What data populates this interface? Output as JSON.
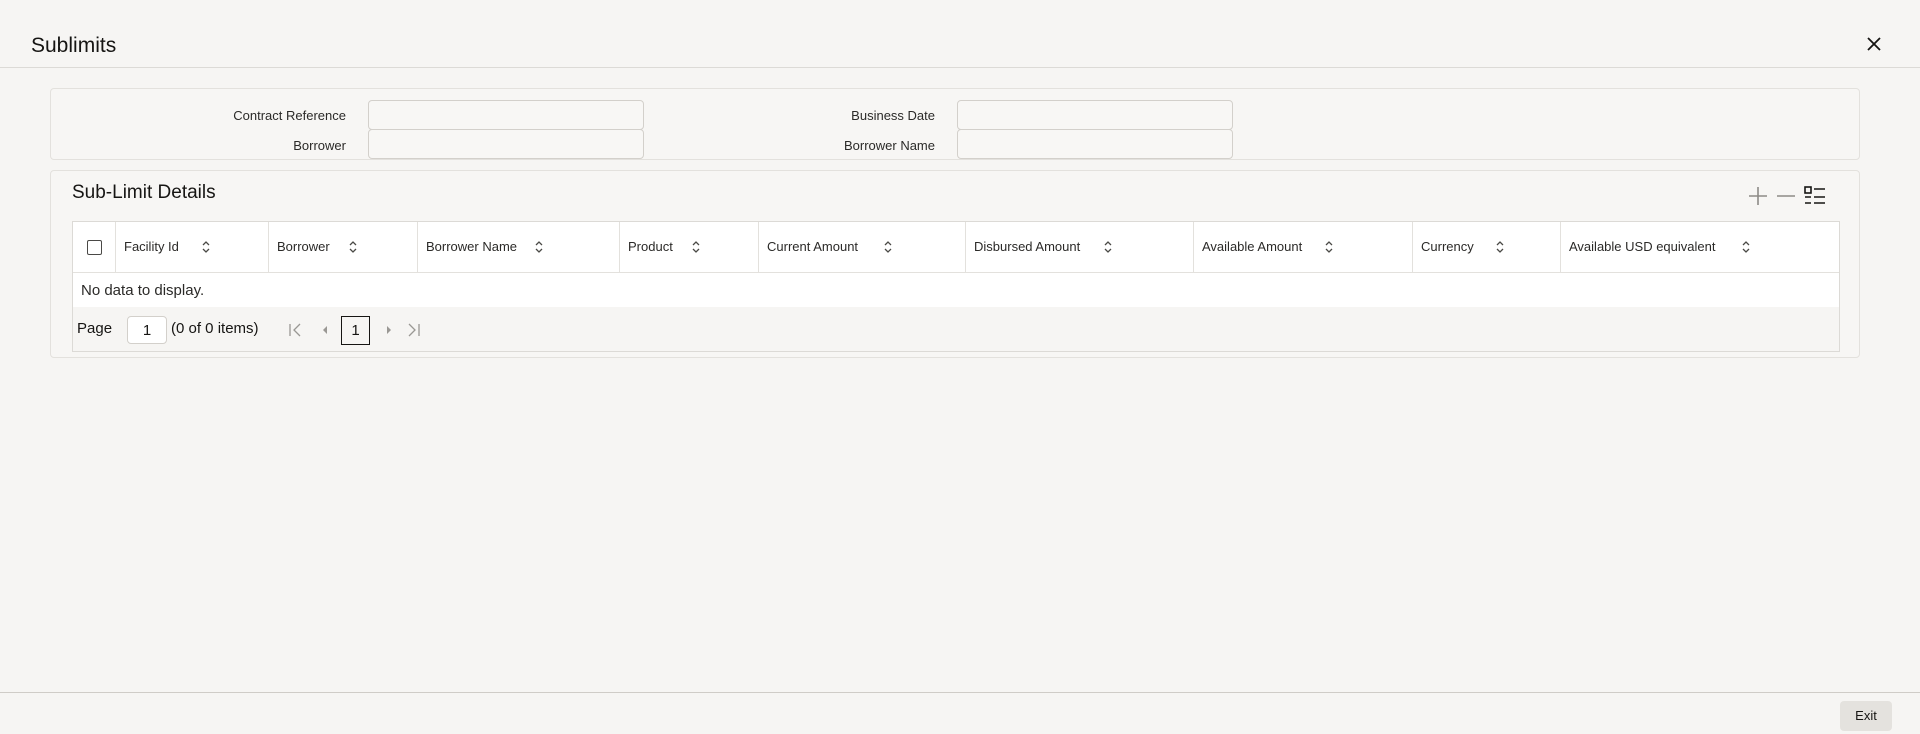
{
  "window": {
    "title": "Sublimits"
  },
  "form": {
    "contract_reference_label": "Contract Reference",
    "contract_reference_value": "",
    "business_date_label": "Business Date",
    "business_date_value": "",
    "borrower_label": "Borrower",
    "borrower_value": "",
    "borrower_name_label": "Borrower Name",
    "borrower_name_value": ""
  },
  "details": {
    "title": "Sub-Limit Details",
    "toolbar_icons": [
      "add-row-icon",
      "delete-row-icon",
      "column-list-icon"
    ],
    "columns": [
      "Facility Id",
      "Borrower",
      "Borrower Name",
      "Product",
      "Current Amount",
      "Disbursed Amount",
      "Available Amount",
      "Currency",
      "Available USD equivalent"
    ],
    "rows": [],
    "empty_message": "No data to display.",
    "pager": {
      "page_label": "Page",
      "page_value": "1",
      "count_text": "(0 of 0 items)",
      "current_page": "1"
    }
  },
  "footer": {
    "exit_label": "Exit"
  },
  "colors": {
    "background": "#f6f5f3",
    "text": "#161513",
    "border": "#dcdad6"
  }
}
